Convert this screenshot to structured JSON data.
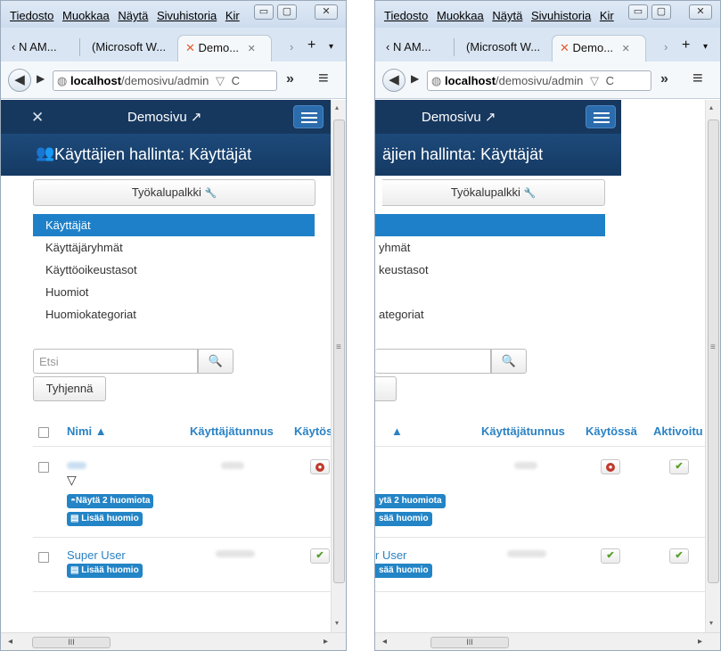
{
  "menu": [
    "Tiedosto",
    "Muokkaa",
    "Näytä",
    "Sivuhistoria",
    "Kir"
  ],
  "window_controls": {
    "minimize": "▭",
    "maximize": "▢",
    "close": "✕"
  },
  "tabs": {
    "left": [
      {
        "label": "‹ N AM...",
        "active": false
      },
      {
        "label": "(Microsoft W...",
        "active": false
      },
      {
        "label": "Demo...",
        "active": true,
        "close": "✕"
      }
    ],
    "right_icons": {
      "forward": "›",
      "new_tab": "+",
      "menu": "▾"
    }
  },
  "url": {
    "host": "localhost",
    "path": "/demosivu/admin"
  },
  "nav_icons": {
    "back": "◀",
    "forward": "▶",
    "globe": "◍",
    "dropdown": "▽",
    "reload": "C",
    "more": "»",
    "hamburger": "≡"
  },
  "site": {
    "name": "Demosivu ↗",
    "logo": "✕"
  },
  "page_title": "Käyttäjien hallinta: Käyttäjät",
  "page_title_icon": "👥",
  "toolbar_label": "Työkalupalkki",
  "toolbar_icon": "🔧",
  "sidebar": [
    {
      "label": "Käyttäjät",
      "active": true
    },
    {
      "label": "Käyttäjäryhmät",
      "active": false
    },
    {
      "label": "Käyttöoikeustasot",
      "active": false
    },
    {
      "label": "Huomiot",
      "active": false
    },
    {
      "label": "Huomiokategoriat",
      "active": false
    }
  ],
  "search": {
    "placeholder": "Etsi",
    "button_icon": "🔍",
    "clear_label": "Tyhjennä"
  },
  "table": {
    "columns": [
      "Nimi ▲",
      "Käyttäjätunnus",
      "Käytössä",
      "Aktivoitu"
    ],
    "left_cut_column": "Käytös",
    "rows": [
      {
        "name": "",
        "filter_icon": "▽",
        "badges": [
          "Näytä 2 huomiota",
          "Lisää huomio"
        ],
        "enabled": false,
        "activated": true
      },
      {
        "name": "Super User",
        "badges": [
          "Lisää huomio"
        ],
        "enabled": true,
        "activated": true
      }
    ]
  },
  "right_view_cuts": {
    "title": "äjien hallinta: Käyttäjät",
    "sidebar": [
      "",
      "yhmät",
      "keustasot",
      "",
      "ategoriat"
    ],
    "badges1": [
      "ytä 2 huomiota",
      "sää huomio"
    ],
    "row2_name": "r User",
    "row2_badge": "sää huomio"
  },
  "icons": {
    "check": "✔",
    "error": "●",
    "sort_asc": "▲",
    "grip": "≡",
    "h_grip": "III",
    "left_arrow": "◂",
    "right_arrow": "▸",
    "up_arrow": "▴",
    "down_arrow": "▾"
  },
  "colors": {
    "navbar": "#17385e",
    "accent": "#1e80c8",
    "link": "#2a82c4",
    "danger": "#c0392b",
    "success": "#5aa02c"
  }
}
